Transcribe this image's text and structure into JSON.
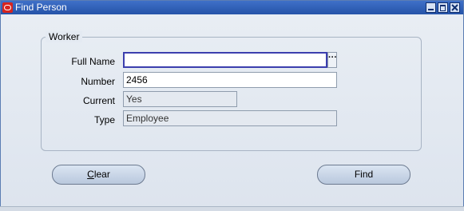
{
  "window": {
    "title": "Find Person"
  },
  "worker_group": {
    "title": "Worker"
  },
  "fields": {
    "full_name": {
      "label": "Full Name",
      "value": ""
    },
    "number": {
      "label": "Number",
      "value": "2456"
    },
    "current": {
      "label": "Current",
      "value": "Yes"
    },
    "type": {
      "label": "Type",
      "value": "Employee"
    }
  },
  "buttons": {
    "clear_mnemonic": "C",
    "clear_rest": "lear",
    "find": "Find"
  },
  "icons": {
    "app": "oracle-icon",
    "list_of_values": "ellipsis-icon",
    "minimize": "minimize-icon",
    "maximize": "maximize-icon",
    "close": "close-icon"
  },
  "colors": {
    "titlebar": "#2f5fb8",
    "focus_border": "#3c3fae",
    "app_icon": "#d6241f"
  }
}
